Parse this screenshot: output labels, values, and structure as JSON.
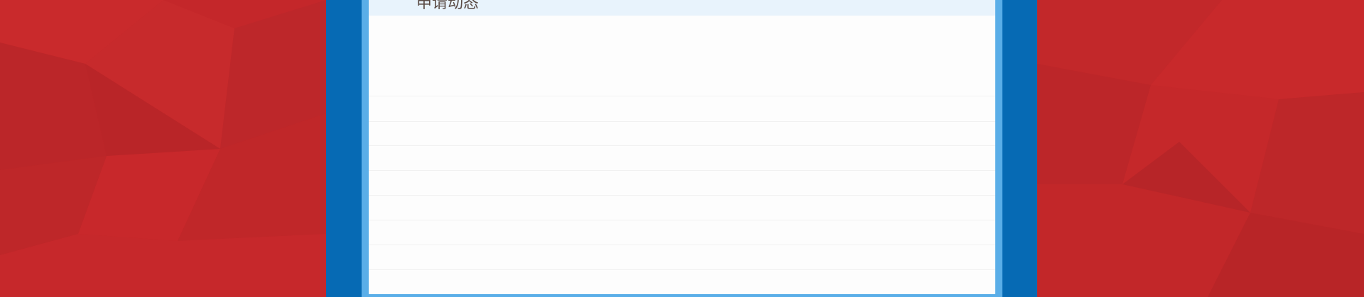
{
  "panel": {
    "title": "申请动态",
    "rows": [
      "",
      "",
      "",
      "",
      "",
      "",
      "",
      ""
    ]
  },
  "colors": {
    "background_red": "#c4272a",
    "frame_blue": "#066ab4",
    "frame_light_blue": "#5aaee8",
    "header_background": "#e8f3fc",
    "panel_background": "#fdfdfd",
    "title_text": "#5a4a44"
  }
}
